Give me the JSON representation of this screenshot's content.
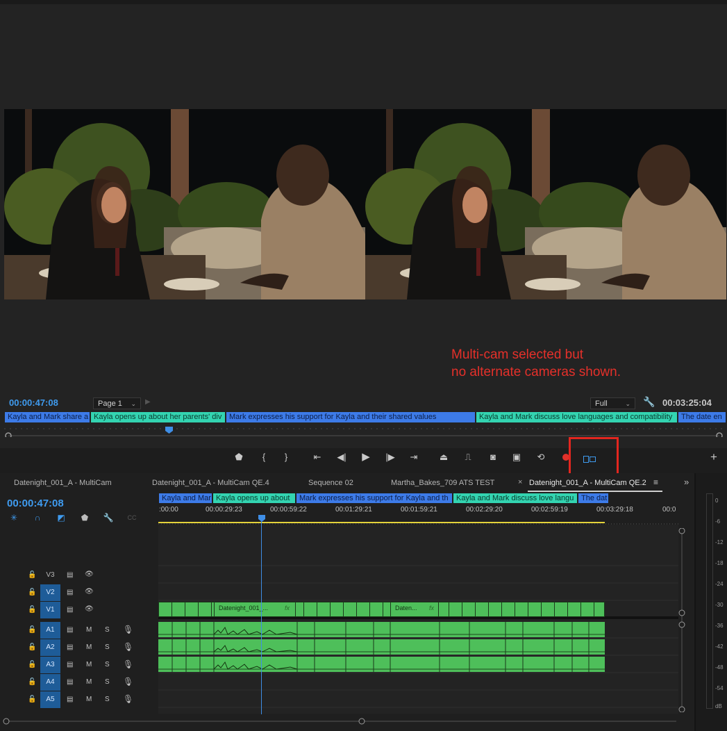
{
  "monitor": {
    "annotation": "Multi-cam selected but\nno alternate cameras shown.",
    "timecode_current": "00:00:47:08",
    "timecode_duration": "00:03:25:04",
    "page_select": "Page 1",
    "zoom_select": "Full"
  },
  "markers": [
    {
      "label": "Kayla and Mark share a",
      "color": "blue"
    },
    {
      "label": "Kayla opens up about her parents' div",
      "color": "cyan"
    },
    {
      "label": "Mark expresses his support for Kayla and their shared values",
      "color": "blue"
    },
    {
      "label": "Kayla and Mark discuss love languages and compatibility",
      "color": "cyan"
    },
    {
      "label": "The date en",
      "color": "blue"
    }
  ],
  "transport": {
    "icons": [
      "marker-icon",
      "in-point-icon",
      "out-point-icon",
      "go-to-in-icon",
      "step-back-icon",
      "play-icon",
      "step-forward-icon",
      "go-to-out-icon",
      "lift-icon",
      "extract-icon",
      "export-frame-icon",
      "comparison-view-icon",
      "proxy-toggle-icon",
      "record-icon",
      "multicam-view-icon",
      "add-button-icon"
    ]
  },
  "tabs": [
    {
      "label": "Datenight_001_A - MultiCam"
    },
    {
      "label": "Datenight_001_A - MultiCam QE.4"
    },
    {
      "label": "Sequence 02"
    },
    {
      "label": "Martha_Bakes_709 ATS TEST"
    },
    {
      "label": "Datenight_001_A - MultiCam QE.2"
    }
  ],
  "timeline": {
    "timecode": "00:00:47:08",
    "markers": [
      {
        "label": "Kayla and Mar",
        "color": "blue"
      },
      {
        "label": "Kayla opens up about",
        "color": "cyan"
      },
      {
        "label": "Mark expresses his support for Kayla and th",
        "color": "blue"
      },
      {
        "label": "Kayla and Mark discuss love langu",
        "color": "cyan"
      },
      {
        "label": "The dat",
        "color": "blue"
      }
    ],
    "ruler": [
      ":00:00",
      "00:00:29:23",
      "00:00:59:22",
      "00:01:29:21",
      "00:01:59:21",
      "00:02:29:20",
      "00:02:59:19",
      "00:03:29:18",
      "00:0"
    ],
    "tracks": [
      {
        "name": "V3",
        "on": false
      },
      {
        "name": "V2",
        "on": true
      },
      {
        "name": "V1",
        "on": true
      },
      {
        "name": "A1",
        "on": true
      },
      {
        "name": "A2",
        "on": true
      },
      {
        "name": "A3",
        "on": true
      },
      {
        "name": "A4",
        "on": true
      },
      {
        "name": "A5",
        "on": true
      }
    ],
    "clip_labels": [
      "Datenight_001_...",
      "Daten..."
    ],
    "audio_btn_m": "M",
    "audio_btn_s": "S"
  },
  "meters": {
    "ticks": [
      "0",
      "-6",
      "-12",
      "-18",
      "-24",
      "-30",
      "-36",
      "-42",
      "-48",
      "-54",
      "dB"
    ]
  },
  "colors": {
    "accent_blue": "#3f9bef",
    "annotation_red": "#e3261f",
    "clip_green": "#4ebf5a",
    "marker_blue": "#3d7be8",
    "marker_cyan": "#33d4b1"
  }
}
